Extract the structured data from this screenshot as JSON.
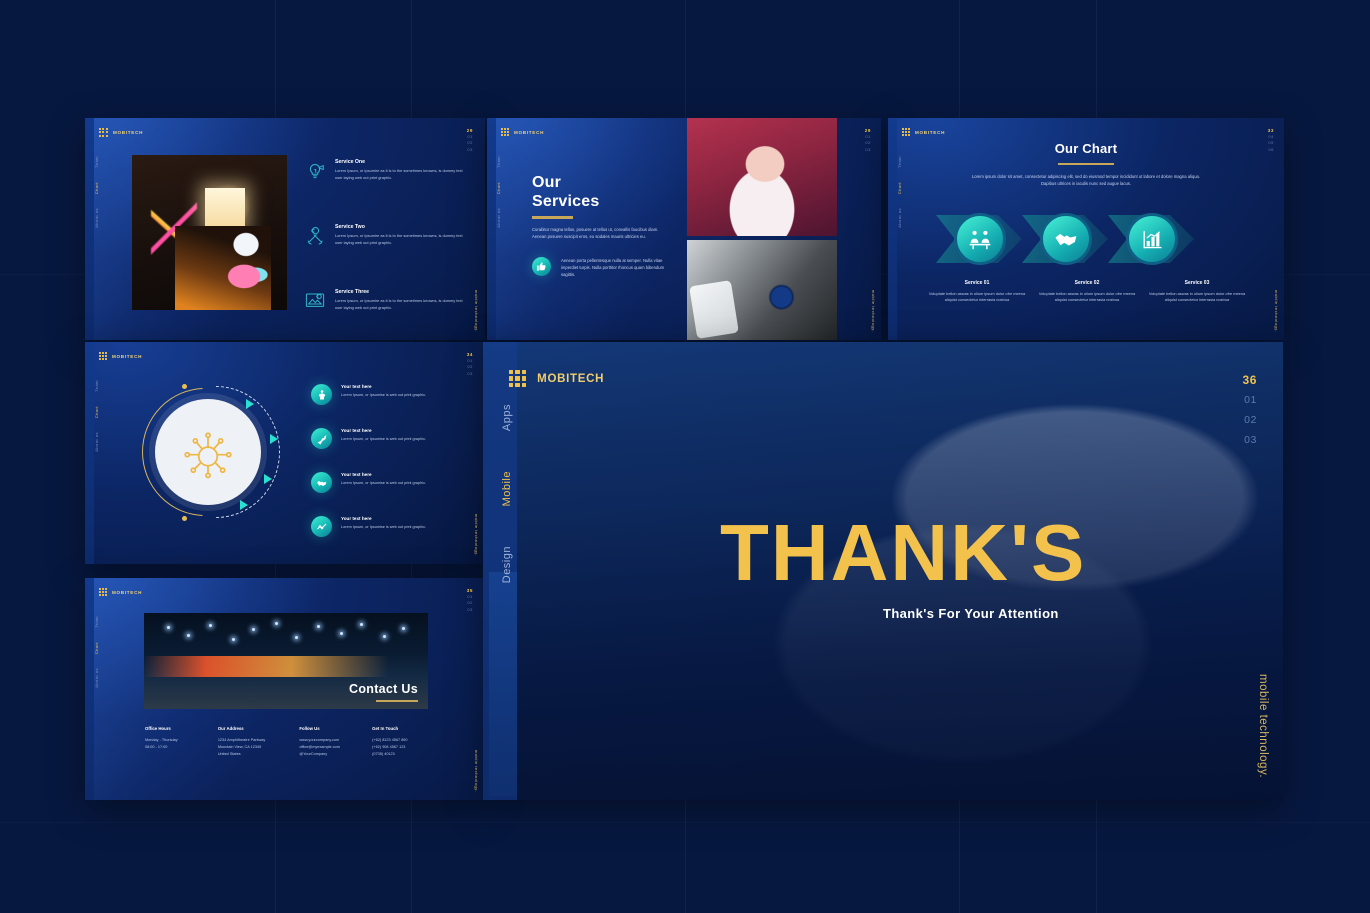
{
  "brand": {
    "name": "MOBITECH",
    "logo_icon": "grid-dots-icon",
    "accent_gold": "#efc34b",
    "accent_teal": "#28d2c8",
    "bg_navy": "#071840"
  },
  "canvas": {
    "background_color": "#071840"
  },
  "slides": [
    {
      "id": "slide-services-icons",
      "nav": [
        "Team",
        "Chart",
        "About us"
      ],
      "nav_active": "Chart",
      "pager": [
        "29",
        "01",
        "02",
        "03"
      ],
      "corner_tag": "mobile technology.",
      "image": "neon-photoshoot-photo",
      "items": [
        {
          "icon": "lightbulb-icon",
          "title": "Service One",
          "body": "Lorem Ipsum, or Ipsumire as it is to the sometimes knowns, is dummy text user laying web out print graphic."
        },
        {
          "icon": "tools-copyright-icon",
          "title": "Service Two",
          "body": "Lorem Ipsum, or Ipsumire as it is to the sometimes knowns, is dummy text user laying web out print graphic."
        },
        {
          "icon": "image-copyright-icon",
          "title": "Service Three",
          "body": "Lorem Ipsum, or Ipsumire as it is to the sometimes knowns, is dummy text user laying web out print graphic."
        }
      ]
    },
    {
      "id": "slide-our-services",
      "nav": [
        "Team",
        "Chart",
        "About us"
      ],
      "nav_active": "Chart",
      "pager": [
        "29",
        "01",
        "02",
        "03"
      ],
      "corner_tag": "mobile technology.",
      "title_line1": "Our",
      "title_line2": "Services",
      "paragraph": "Curabitur magna tellus, posuere at tellus ut, convallis faucibus diam. Aenean posuere suscipit eros, eu sodales mauris ultricies eu.",
      "feature": {
        "icon": "thumbs-up-icon",
        "body": "Aenean porta pellentesque nulla at semper. Nulla vitae imperdiet turpis. Nulla porttitor rhoncus quam bibendum sagittis."
      },
      "images": [
        "portrait-red-light-photo",
        "watch-and-phone-flatlay-photo"
      ]
    },
    {
      "id": "slide-our-chart",
      "nav": [
        "Team",
        "Chart",
        "About us"
      ],
      "nav_active": "Chart",
      "pager": [
        "33",
        "04",
        "05",
        "06"
      ],
      "corner_tag": "mobile technology.",
      "title": "Our Chart",
      "paragraph": "Lorem ipsum dolor sit amet, consectetur adipiscing elit, sed do eiusmod tempor incididunt ut labore et dolore magna aliqua. Dapibus ultrices in iaculis nunc sed augue lacus.",
      "steps": [
        {
          "icon": "team-meeting-icon",
          "label": "Service 01",
          "body": "Voluptate bellon aswas in olium ipsum dolor ofre meena aliquist consectetur interrasia nostrua"
        },
        {
          "icon": "handshake-icon",
          "label": "Service 02",
          "body": "Voluptate bellon aswas in olium ipsum dolor ofre meena aliquist consectetur interrasia nostrua"
        },
        {
          "icon": "bar-chart-icon",
          "label": "Service 03",
          "body": "Voluptate bellon aswas in olium ipsum dolor ofre meena aliquist consectetur interrasia nostrua"
        }
      ]
    },
    {
      "id": "slide-circle-infographic",
      "nav": [
        "Team",
        "Chart",
        "About us"
      ],
      "nav_active": "Chart",
      "pager": [
        "34",
        "01",
        "02",
        "03"
      ],
      "corner_tag": "mobile technology.",
      "center_icon": "circuit-chip-icon",
      "items": [
        {
          "icon": "person-growth-icon",
          "title": "Your text here",
          "body": "Lorem Ipsum, or Ipsumise is web out print graphic."
        },
        {
          "icon": "rocket-growth-icon",
          "title": "Your text here",
          "body": "Lorem Ipsum, or Ipsumise is web out print graphic."
        },
        {
          "icon": "handshake-icon",
          "title": "Your text here",
          "body": "Lorem Ipsum, or Ipsumise is web out print graphic."
        },
        {
          "icon": "line-chart-icon",
          "title": "Your text here",
          "body": "Lorem Ipsum, or Ipsumise is web out print graphic."
        }
      ]
    },
    {
      "id": "slide-contact-us",
      "nav": [
        "Team",
        "Chart",
        "About us"
      ],
      "nav_active": "Chart",
      "pager": [
        "35",
        "01",
        "02",
        "03"
      ],
      "corner_tag": "mobile technology.",
      "image": "city-light-trails-photo",
      "overlay_title": "Contact Us",
      "columns": [
        {
          "heading": "Office Hours",
          "lines": [
            "Monday - Thursday",
            "08:00 - 17:00"
          ]
        },
        {
          "heading": "Our Address",
          "lines": [
            "1234 Amphitheatre Parkway",
            "Mountain View, CA 12345",
            "United States"
          ]
        },
        {
          "heading": "Follow Us",
          "lines": [
            "www.yourcompany.com",
            "office@myexample.com",
            "@YourCompany"
          ]
        },
        {
          "heading": "Get In Touch",
          "lines": [
            "(+62) 8123 4567 890",
            "(+62) 908 4567 123",
            "(0735) 40123"
          ]
        }
      ]
    }
  ],
  "thanks_slide": {
    "id": "slide-thanks",
    "nav": [
      "Apps",
      "Mobile",
      "Design"
    ],
    "nav_active": "Mobile",
    "pager": [
      "36",
      "01",
      "02",
      "03"
    ],
    "corner_tag": "mobile technology.",
    "title": "THANK'S",
    "subtitle": "Thank's For Your Attention",
    "image": "hand-holding-phone-photo"
  }
}
